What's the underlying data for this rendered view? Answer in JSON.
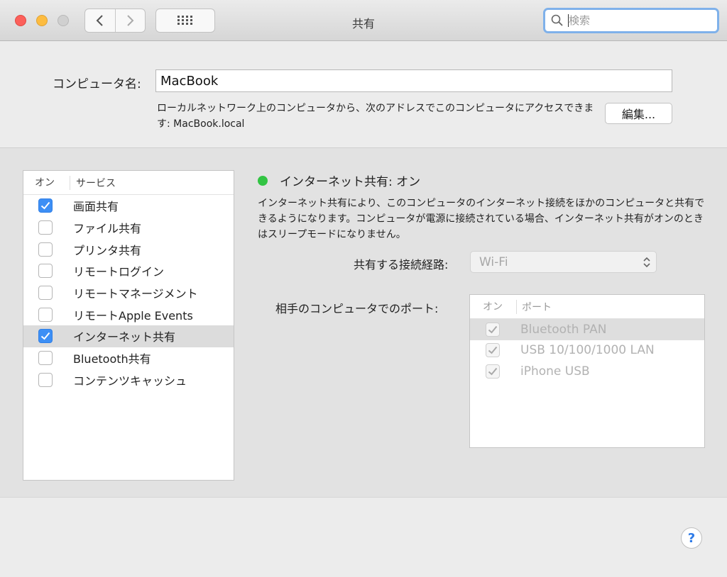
{
  "window": {
    "title": "共有"
  },
  "search": {
    "placeholder": "検索",
    "value": ""
  },
  "computer_name": {
    "label": "コンピュータ名:",
    "value": "MacBook",
    "address_text": "ローカルネットワーク上のコンピュータから、次のアドレスでこのコンピュータにアクセスできます: MacBook.local",
    "edit_label": "編集..."
  },
  "services": {
    "header_on": "オン",
    "header_service": "サービス",
    "items": [
      {
        "label": "画面共有",
        "checked": true,
        "selected": false
      },
      {
        "label": "ファイル共有",
        "checked": false,
        "selected": false
      },
      {
        "label": "プリンタ共有",
        "checked": false,
        "selected": false
      },
      {
        "label": "リモートログイン",
        "checked": false,
        "selected": false
      },
      {
        "label": "リモートマネージメント",
        "checked": false,
        "selected": false
      },
      {
        "label": "リモートApple Events",
        "checked": false,
        "selected": false
      },
      {
        "label": "インターネット共有",
        "checked": true,
        "selected": true
      },
      {
        "label": "Bluetooth共有",
        "checked": false,
        "selected": false
      },
      {
        "label": "コンテンツキャッシュ",
        "checked": false,
        "selected": false
      }
    ]
  },
  "detail": {
    "status": "インターネット共有: オン",
    "status_color": "#32c443",
    "description": "インターネット共有により、このコンピュータのインターネット接続をほかのコンピュータと共有できるようになります。コンピュータが電源に接続されている場合、インターネット共有がオンのときはスリープモードになりません。",
    "route_label": "共有する接続経路:",
    "route_value": "Wi-Fi",
    "ports_label": "相手のコンピュータでのポート:",
    "ports_header_on": "オン",
    "ports_header_port": "ポート",
    "ports": [
      {
        "label": "Bluetooth PAN",
        "checked": true,
        "selected": true
      },
      {
        "label": "USB 10/100/1000 LAN",
        "checked": true,
        "selected": false
      },
      {
        "label": "iPhone USB",
        "checked": true,
        "selected": false
      }
    ]
  },
  "help": {
    "label": "?"
  },
  "colors": {
    "accent": "#3d8ff5",
    "search_focus": "#7fb1ea"
  }
}
